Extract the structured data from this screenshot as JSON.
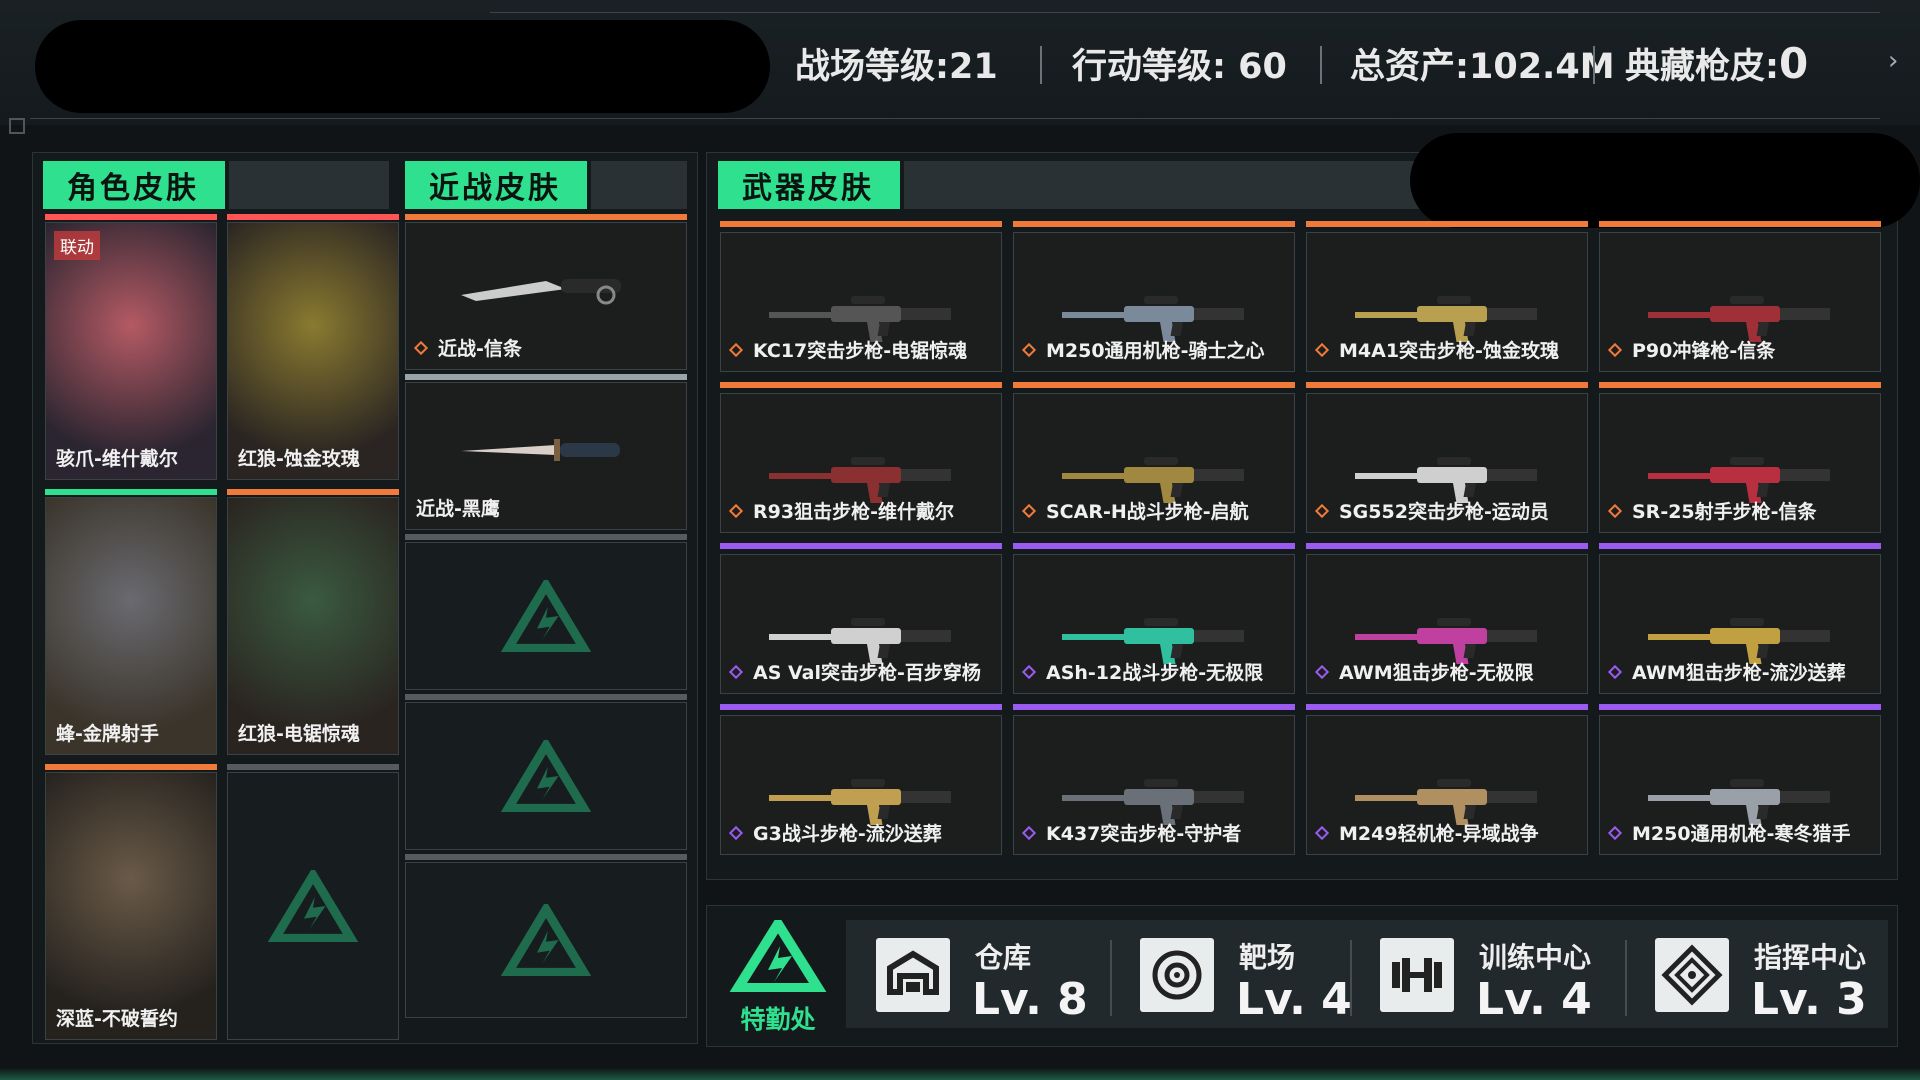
{
  "topbar": {
    "battle_level": "战场等级:21",
    "action_level": "行动等级: 60",
    "total_assets": "总资产:102.4M",
    "collection_skins": "典藏枪皮:",
    "collection_count": "0"
  },
  "sections": {
    "character": "角色皮肤",
    "melee": "近战皮肤",
    "weapon": "武器皮肤"
  },
  "characters": [
    {
      "label": "骇爪-维什戴尔",
      "badge": "联动",
      "color": "#ff5555"
    },
    {
      "label": "红狼-蚀金玫瑰",
      "color": "#ff5555"
    },
    {
      "label": "蜂-金牌射手",
      "color": "#2fe08f"
    },
    {
      "label": "红狼-电锯惊魂",
      "color": "#f07a3a"
    },
    {
      "label": "深蓝-不破誓约",
      "color": "#f07a3a"
    }
  ],
  "melee": [
    {
      "label": "近战-信条",
      "color": "#f07a3a"
    },
    {
      "label": "近战-黑鹰",
      "color": "#9aa3a8"
    }
  ],
  "weapons": [
    {
      "label": "KC17突击步枪-电锯惊魂",
      "tier": "orange"
    },
    {
      "label": "M250通用机枪-骑士之心",
      "tier": "orange"
    },
    {
      "label": "M4A1突击步枪-蚀金玫瑰",
      "tier": "orange"
    },
    {
      "label": "P90冲锋枪-信条",
      "tier": "orange"
    },
    {
      "label": "R93狙击步枪-维什戴尔",
      "tier": "orange"
    },
    {
      "label": "SCAR-H战斗步枪-启航",
      "tier": "orange"
    },
    {
      "label": "SG552突击步枪-运动员",
      "tier": "orange"
    },
    {
      "label": "SR-25射手步枪-信条",
      "tier": "orange"
    },
    {
      "label": "AS Val突击步枪-百步穿杨",
      "tier": "purple"
    },
    {
      "label": "ASh-12战斗步枪-无极限",
      "tier": "purple"
    },
    {
      "label": "AWM狙击步枪-无极限",
      "tier": "purple"
    },
    {
      "label": "AWM狙击步枪-流沙送葬",
      "tier": "purple"
    },
    {
      "label": "G3战斗步枪-流沙送葬",
      "tier": "purple"
    },
    {
      "label": "K437突击步枪-守护者",
      "tier": "purple"
    },
    {
      "label": "M249轻机枪-异域战争",
      "tier": "purple"
    },
    {
      "label": "M250通用机枪-寒冬猎手",
      "tier": "purple"
    }
  ],
  "colors": {
    "orange": "#f07a3a",
    "purple": "#9a5cf0",
    "accent": "#2fe08f"
  },
  "facilities": {
    "brand": "特勤处",
    "items": [
      {
        "name": "仓库",
        "level": "Lv. 8",
        "icon": "warehouse-icon"
      },
      {
        "name": "靶场",
        "level": "Lv. 4",
        "icon": "target-icon"
      },
      {
        "name": "训练中心",
        "level": "Lv. 4",
        "icon": "dumbbell-icon"
      },
      {
        "name": "指挥中心",
        "level": "Lv. 3",
        "icon": "command-icon"
      }
    ]
  }
}
